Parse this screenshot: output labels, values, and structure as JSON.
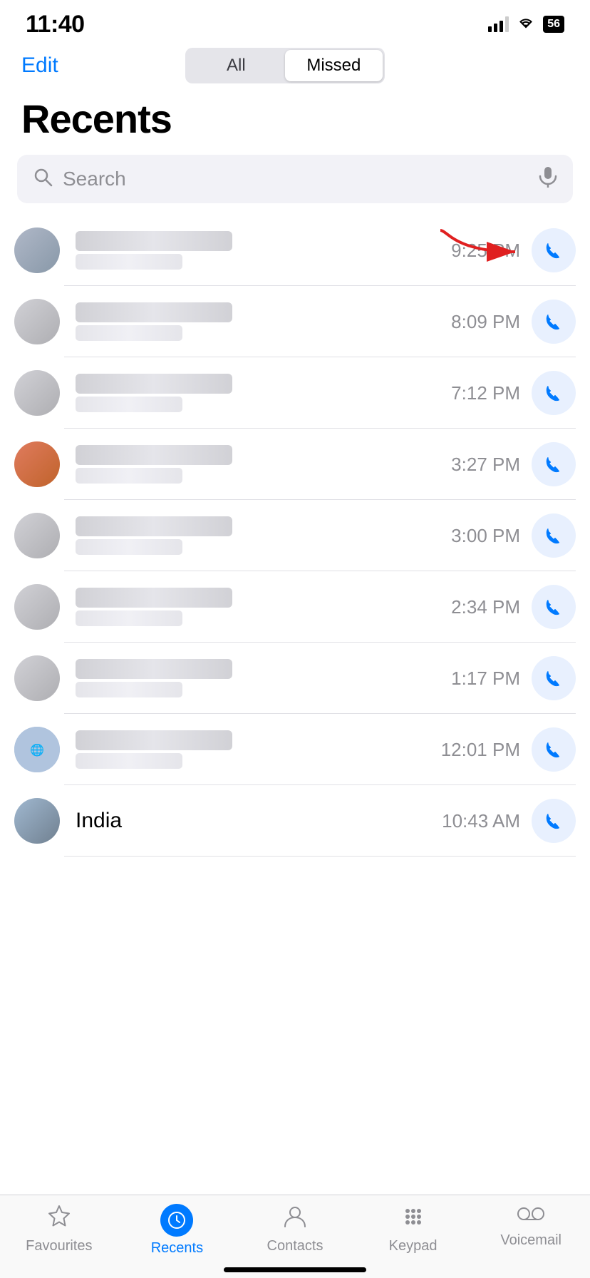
{
  "statusBar": {
    "time": "11:40",
    "battery": "56"
  },
  "navBar": {
    "editLabel": "Edit",
    "segments": [
      {
        "label": "All",
        "active": false
      },
      {
        "label": "Missed",
        "active": true
      }
    ]
  },
  "pageTitle": "Recents",
  "search": {
    "placeholder": "Search"
  },
  "calls": [
    {
      "time": "9:25 PM",
      "hasArrow": true
    },
    {
      "time": "8:09 PM",
      "hasArrow": false
    },
    {
      "time": "7:12 PM",
      "hasArrow": false
    },
    {
      "time": "3:27 PM",
      "hasArrow": false
    },
    {
      "time": "3:00 PM",
      "hasArrow": false
    },
    {
      "time": "2:34 PM",
      "hasArrow": false
    },
    {
      "time": "1:17 PM",
      "hasArrow": false
    },
    {
      "time": "12:01 PM",
      "hasArrow": false
    },
    {
      "time": "10:43 AM",
      "hasArrow": false
    }
  ],
  "lastContact": {
    "name": "India"
  },
  "tabs": [
    {
      "label": "Favourites",
      "icon": "star",
      "active": false
    },
    {
      "label": "Recents",
      "icon": "clock",
      "active": true
    },
    {
      "label": "Contacts",
      "icon": "person",
      "active": false
    },
    {
      "label": "Keypad",
      "icon": "keypad",
      "active": false
    },
    {
      "label": "Voicemail",
      "icon": "voicemail",
      "active": false
    }
  ]
}
